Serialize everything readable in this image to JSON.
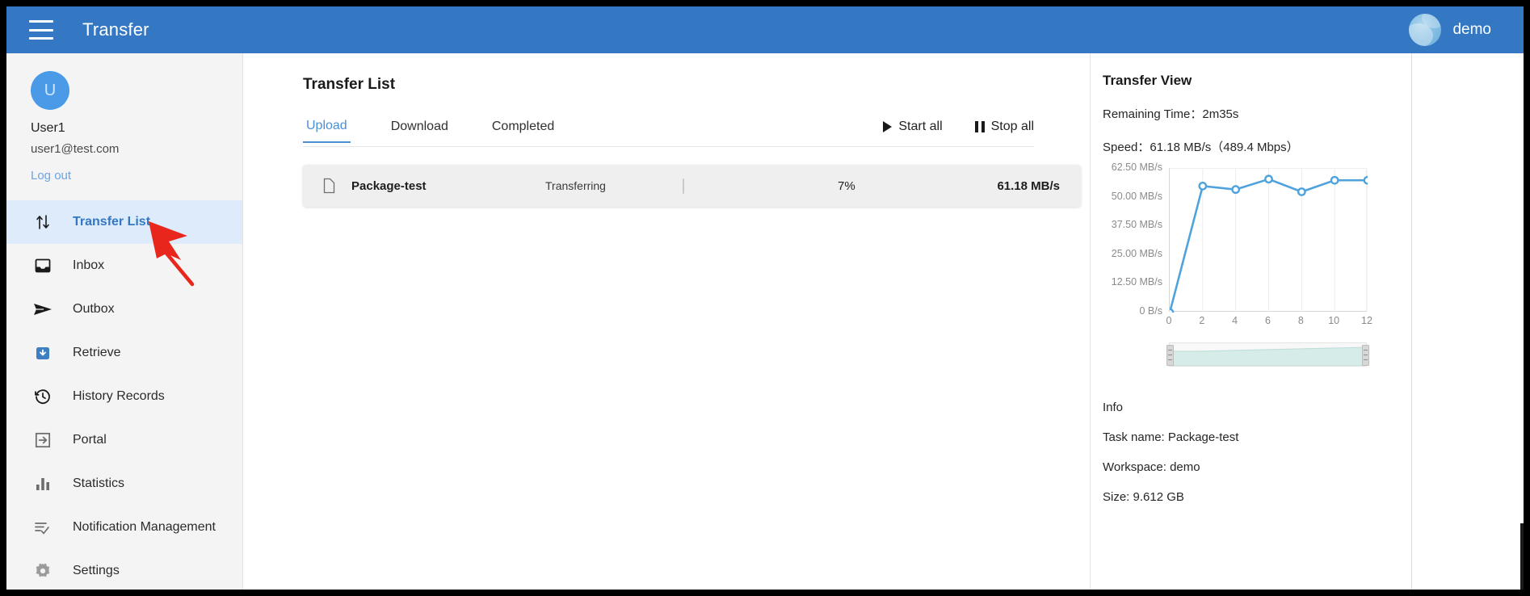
{
  "topbar": {
    "menu_icon": "hamburger-icon",
    "app_title": "Transfer",
    "user_name": "demo",
    "avatar_icon": "globe-avatar-icon",
    "background_color": "#3478c4"
  },
  "sidebar": {
    "profile": {
      "avatar_initial": "U",
      "name": "User1",
      "email": "user1@test.com",
      "logout_label": "Log out"
    },
    "items": [
      {
        "label": "Transfer List",
        "icon": "transfer-arrows-icon",
        "active": true
      },
      {
        "label": "Inbox",
        "icon": "inbox-icon",
        "active": false
      },
      {
        "label": "Outbox",
        "icon": "send-paper-plane-icon",
        "active": false
      },
      {
        "label": "Retrieve",
        "icon": "download-box-icon",
        "active": false
      },
      {
        "label": "History Records",
        "icon": "history-clock-icon",
        "active": false
      },
      {
        "label": "Portal",
        "icon": "portal-enter-icon",
        "active": false
      },
      {
        "label": "Statistics",
        "icon": "bar-chart-icon",
        "active": false
      },
      {
        "label": "Notification Management",
        "icon": "notification-check-list-icon",
        "active": false
      },
      {
        "label": "Settings",
        "icon": "gear-icon",
        "active": false
      }
    ],
    "active_color": "#3478c4",
    "active_background": "#ddebfa"
  },
  "annotation": {
    "arrow_color": "#e8261c",
    "points_to": "Transfer List"
  },
  "main": {
    "title": "Transfer List",
    "tabs": [
      {
        "label": "Upload",
        "active": true
      },
      {
        "label": "Download",
        "active": false
      },
      {
        "label": "Completed",
        "active": false
      }
    ],
    "actions": [
      {
        "label": "Start all",
        "icon": "play-icon"
      },
      {
        "label": "Stop all",
        "icon": "pause-icon"
      }
    ],
    "transfer_rows": [
      {
        "file_icon": "document-icon",
        "name": "Package-test",
        "status": "Transferring",
        "progress_pct": 7,
        "progress_label": "7%",
        "speed": "61.18 MB/s"
      }
    ]
  },
  "transfer_view": {
    "title": "Transfer View",
    "remaining_time_label": "Remaining Time：2m35s",
    "speed_label": "Speed：61.18 MB/s（489.4 Mbps）",
    "info_heading": "Info",
    "info": [
      "Task name: Package-test",
      "Workspace: demo",
      "Size: 9.612 GB"
    ],
    "brush": {
      "left_handle": "range-handle-left",
      "right_handle": "range-handle-right"
    }
  },
  "chart_data": {
    "type": "line",
    "title": "",
    "xlabel": "",
    "ylabel": "",
    "x": [
      0,
      1,
      2,
      3,
      4,
      5,
      6,
      7,
      8,
      9,
      10,
      11,
      12
    ],
    "series": [
      {
        "name": "Speed",
        "values": [
          0,
          null,
          55.0,
          null,
          53.5,
          null,
          58.0,
          null,
          52.5,
          null,
          57.5,
          null,
          57.5
        ]
      }
    ],
    "points": [
      {
        "x": 0,
        "y": 0
      },
      {
        "x": 2,
        "y": 55.0
      },
      {
        "x": 4,
        "y": 53.5
      },
      {
        "x": 6,
        "y": 58.0
      },
      {
        "x": 8,
        "y": 52.5
      },
      {
        "x": 10,
        "y": 57.5
      },
      {
        "x": 12,
        "y": 57.5
      }
    ],
    "ytick_labels": [
      "0 B/s",
      "12.50 MB/s",
      "25.00 MB/s",
      "37.50 MB/s",
      "50.00 MB/s",
      "62.50 MB/s"
    ],
    "ytick_values": [
      0,
      12.5,
      25,
      37.5,
      50,
      62.5
    ],
    "xtick_labels": [
      "0",
      "2",
      "4",
      "6",
      "8",
      "10",
      "12"
    ],
    "xtick_values": [
      0,
      2,
      4,
      6,
      8,
      10,
      12
    ],
    "ylim": [
      0,
      62.5
    ],
    "xlim": [
      0,
      12
    ],
    "grid": true,
    "line_color": "#4fa3dc",
    "marker": "open-circle",
    "legend": "none"
  }
}
